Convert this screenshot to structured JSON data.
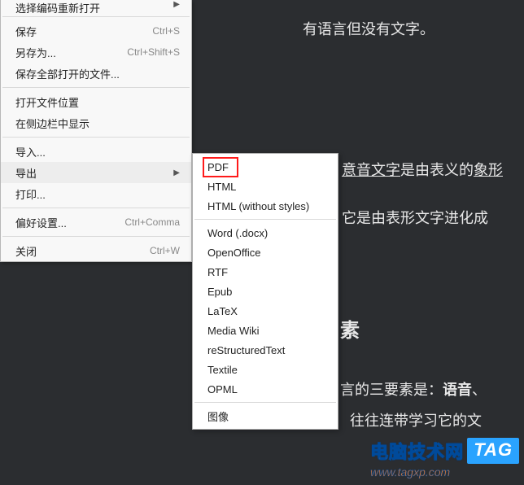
{
  "background": {
    "line1": "有语言但没有文字。",
    "line2a": "意音",
    "line2b": "文字",
    "line2c": "是由表义的",
    "line2d": "象形",
    "line3": "它是由表形文字进化成",
    "line4_suffix": "素",
    "line5a": "言的三要素是：",
    "line5b": "语音",
    "line5c": "、",
    "line6": "往往连带学习它的文"
  },
  "menu": {
    "top_cut_label": "选择编码重新打开",
    "items": [
      {
        "label": "保存",
        "shortcut": "Ctrl+S"
      },
      {
        "label": "另存为...",
        "shortcut": "Ctrl+Shift+S"
      },
      {
        "label": "保存全部打开的文件..."
      }
    ],
    "group2": [
      {
        "label": "打开文件位置"
      },
      {
        "label": "在侧边栏中显示"
      }
    ],
    "group3": [
      {
        "label": "导入..."
      },
      {
        "label": "导出",
        "submenu": true,
        "hover": true
      },
      {
        "label": "打印..."
      }
    ],
    "group4": [
      {
        "label": "偏好设置...",
        "shortcut": "Ctrl+Comma"
      }
    ],
    "group5": [
      {
        "label": "关闭",
        "shortcut": "Ctrl+W"
      }
    ]
  },
  "submenu": {
    "group1": [
      {
        "label": "PDF"
      },
      {
        "label": "HTML"
      },
      {
        "label": "HTML (without styles)"
      }
    ],
    "group2": [
      {
        "label": "Word (.docx)"
      },
      {
        "label": "OpenOffice"
      },
      {
        "label": "RTF"
      },
      {
        "label": "Epub"
      },
      {
        "label": "LaTeX"
      },
      {
        "label": "Media Wiki"
      },
      {
        "label": "reStructuredText"
      },
      {
        "label": "Textile"
      },
      {
        "label": "OPML"
      }
    ],
    "group3": [
      {
        "label": "图像"
      }
    ]
  },
  "watermark": {
    "brand": "电脑技术网",
    "badge": "TAG",
    "url": "www.tagxp.com"
  },
  "colors": {
    "bg": "#2b2d30",
    "menu_bg": "#f8f8f8",
    "submenu_bg": "#ffffff",
    "highlight": "#ff1a1a",
    "badge": "#2aa3ff",
    "brand_fill": "#ff7a1a"
  }
}
